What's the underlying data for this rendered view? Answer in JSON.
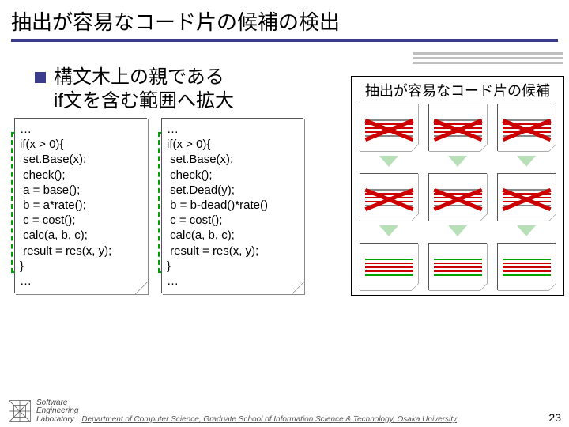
{
  "title": "抽出が容易なコード片の候補の検出",
  "bullet": {
    "line1": "構文木上の親である",
    "line2": "if文を含む範囲へ拡大"
  },
  "code_left": {
    "l0": "…",
    "l1": "if(x > 0){",
    "l2": " set.Base(x);",
    "l3": " check();",
    "l4": " a = base();",
    "l5": " b = a*rate();",
    "l6": " c = cost();",
    "l7": " calc(a, b, c);",
    "l8": " result = res(x, y);",
    "l9": "}",
    "l10": "…"
  },
  "code_right": {
    "l0": "…",
    "l1": "if(x > 0){",
    "l2": " set.Base(x);",
    "l3": " check();",
    "l4": " set.Dead(y);",
    "l5": " b = b-dead()*rate()",
    "l6": " c = cost();",
    "l7": " calc(a, b, c);",
    "l8": " result = res(x, y);",
    "l9": "}",
    "l10": "…"
  },
  "right_panel": {
    "title": "抽出が容易なコード片の候補"
  },
  "footer": {
    "logo1": "Software",
    "logo2": "Engineering",
    "logo3": "Laboratory",
    "dept": "Department of Computer Science, Graduate School of Information Science & Technology, Osaka University",
    "page": "23"
  }
}
